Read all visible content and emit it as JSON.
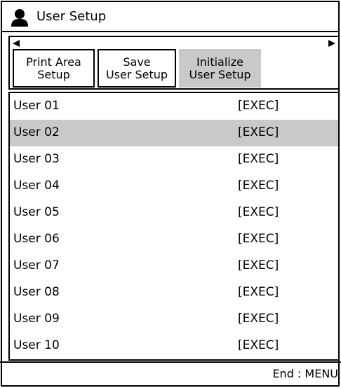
{
  "window": {
    "title": "User Setup",
    "icon": "user-icon"
  },
  "tabs": [
    {
      "line1": "Print Area",
      "line2": "Setup",
      "selected": false
    },
    {
      "line1": "Save",
      "line2": "User Setup",
      "selected": false
    },
    {
      "line1": "Initialize",
      "line2": "User Setup",
      "selected": true
    }
  ],
  "scroll_arrows": {
    "left": "arrow-left",
    "right": "arrow-right"
  },
  "users": [
    {
      "name": "User 01",
      "action": "[EXEC]",
      "selected": false
    },
    {
      "name": "User 02",
      "action": "[EXEC]",
      "selected": true
    },
    {
      "name": "User 03",
      "action": "[EXEC]",
      "selected": false
    },
    {
      "name": "User 04",
      "action": "[EXEC]",
      "selected": false
    },
    {
      "name": "User 05",
      "action": "[EXEC]",
      "selected": false
    },
    {
      "name": "User 06",
      "action": "[EXEC]",
      "selected": false
    },
    {
      "name": "User 07",
      "action": "[EXEC]",
      "selected": false
    },
    {
      "name": "User 08",
      "action": "[EXEC]",
      "selected": false
    },
    {
      "name": "User 09",
      "action": "[EXEC]",
      "selected": false
    },
    {
      "name": "User 10",
      "action": "[EXEC]",
      "selected": false
    }
  ],
  "footer": {
    "hint": "End : MENU"
  },
  "colors": {
    "selection": "#c9c9c9",
    "border": "#000000",
    "background": "#ffffff"
  }
}
